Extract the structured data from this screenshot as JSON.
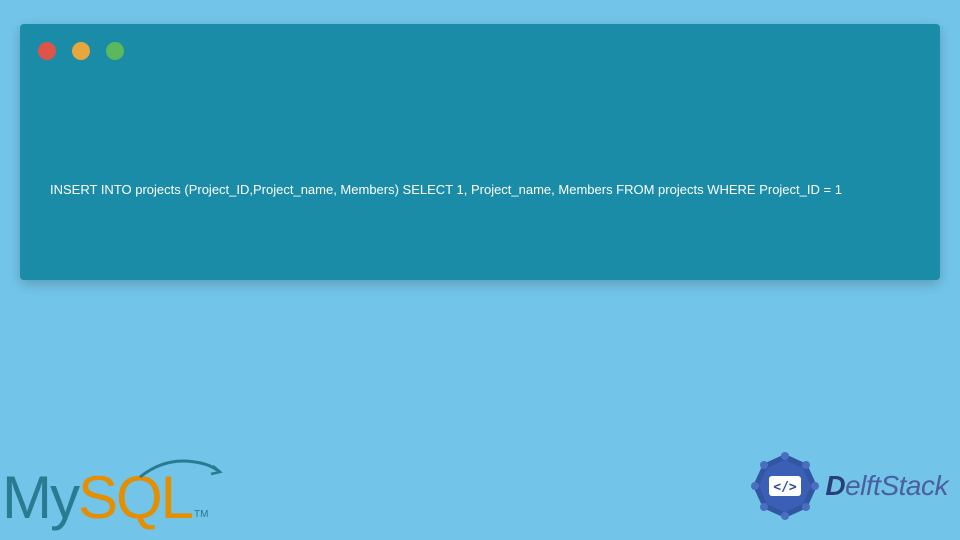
{
  "terminal": {
    "code": "INSERT INTO projects (Project_ID,Project_name, Members) SELECT 1, Project_name, Members FROM projects WHERE Project_ID = 1"
  },
  "logos": {
    "mysql_my": "My",
    "mysql_sql": "SQL",
    "mysql_tm": "TM",
    "delft_d": "D",
    "delft_rest": "elftStack"
  }
}
